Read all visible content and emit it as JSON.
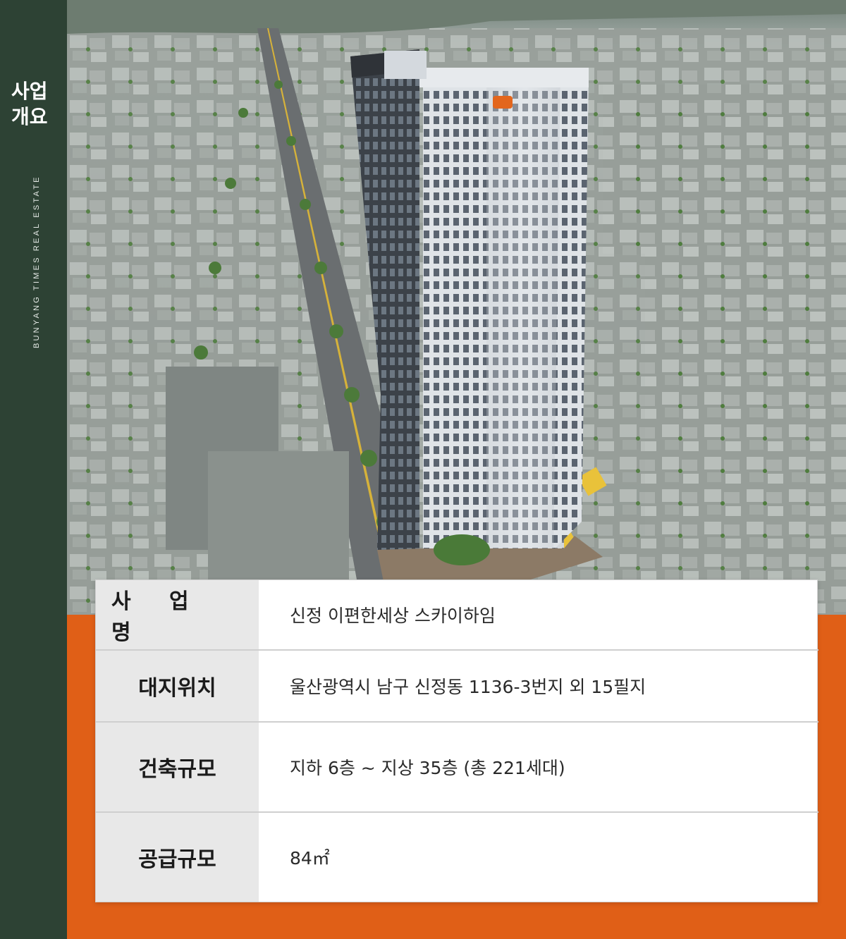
{
  "sidebar": {
    "title_line1": "사업",
    "title_line2": "개요",
    "subtitle": "BUNYANG TIMES REAL ESTATE"
  },
  "colors": {
    "sidebar_green": "#2d4234",
    "accent_orange": "#e05f17",
    "label_bg": "#e8e8e8"
  },
  "overview": {
    "rows": [
      {
        "label": "사 업 명",
        "value": "신정 이편한세상 스카이하임"
      },
      {
        "label": "대지위치",
        "value": "울산광역시 남구 신정동 1136-3번지 외 15필지"
      },
      {
        "label": "건축규모",
        "value": "지하 6층 ~ 지상 35층 (총 221세대)"
      },
      {
        "label": "공급규모",
        "value": "84㎡"
      }
    ]
  }
}
